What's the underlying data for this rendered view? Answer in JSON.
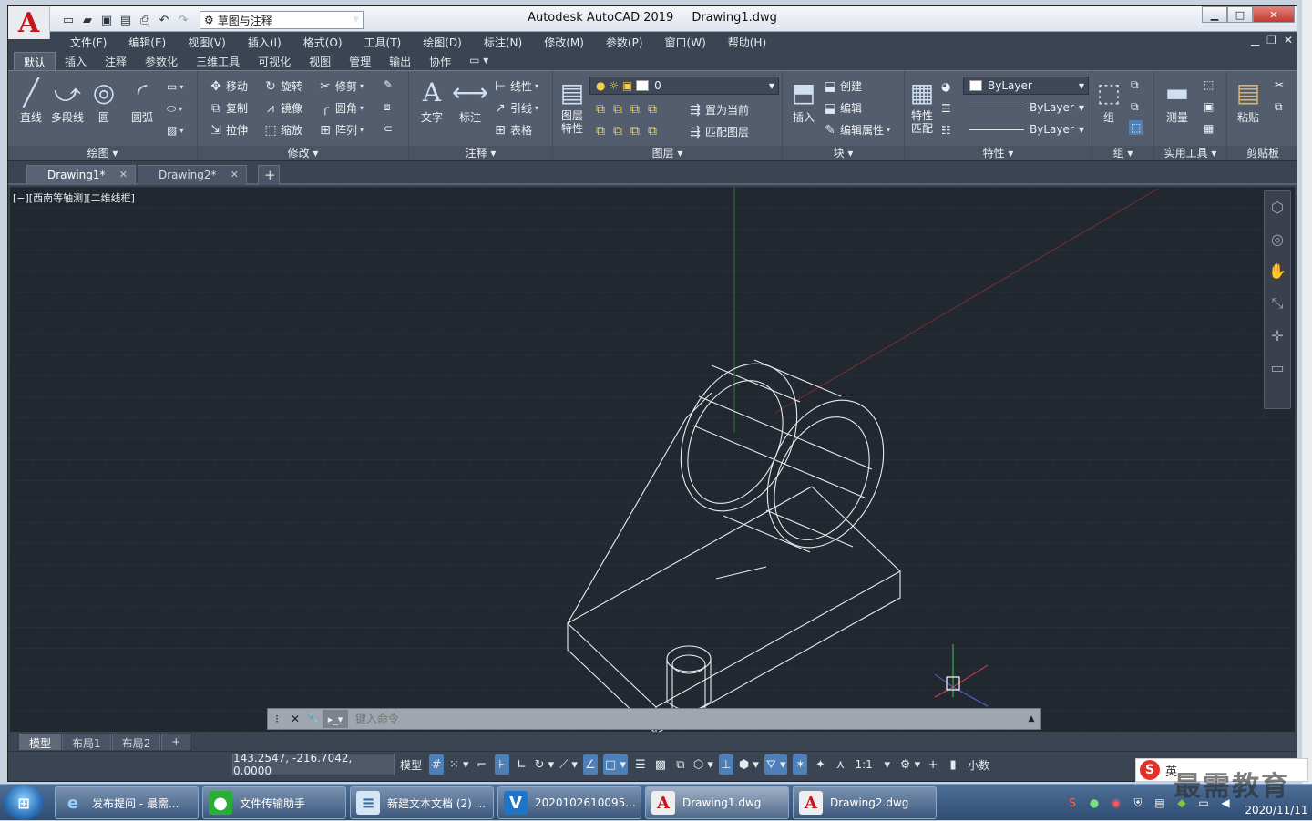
{
  "window": {
    "title_app": "Autodesk AutoCAD 2019",
    "title_file": "Drawing1.dwg",
    "logo": "A"
  },
  "qat": {
    "workspace": "草图与注释"
  },
  "menus": [
    "文件(F)",
    "编辑(E)",
    "视图(V)",
    "插入(I)",
    "格式(O)",
    "工具(T)",
    "绘图(D)",
    "标注(N)",
    "修改(M)",
    "参数(P)",
    "窗口(W)",
    "帮助(H)"
  ],
  "ribbon_tabs": [
    "默认",
    "插入",
    "注释",
    "参数化",
    "三维工具",
    "可视化",
    "视图",
    "管理",
    "输出",
    "协作"
  ],
  "ribbon": {
    "draw": {
      "title": "绘图",
      "line": "直线",
      "polyline": "多段线",
      "circle": "圆",
      "arc": "圆弧"
    },
    "modify": {
      "title": "修改",
      "move": "移动",
      "rotate": "旋转",
      "trim": "修剪",
      "copy": "复制",
      "mirror": "镜像",
      "fillet": "圆角",
      "stretch": "拉伸",
      "scale": "缩放",
      "array": "阵列"
    },
    "annotation": {
      "title": "注释",
      "text": "文字",
      "dimension": "标注",
      "linear": "线性",
      "leader": "引线",
      "table": "表格"
    },
    "layers": {
      "title": "图层",
      "layer_props_1": "图层",
      "layer_props_2": "特性",
      "current_layer": "0",
      "set_current": "置为当前",
      "match_layer": "匹配图层"
    },
    "block": {
      "title": "块",
      "insert": "插入",
      "create": "创建",
      "edit": "编辑",
      "edit_attr": "编辑属性"
    },
    "properties": {
      "title": "特性",
      "match_1": "特性",
      "match_2": "匹配",
      "color": "ByLayer",
      "linetype": "ByLayer",
      "lineweight": "ByLayer"
    },
    "groups": {
      "title": "组",
      "group": "组"
    },
    "utilities": {
      "title": "实用工具",
      "measure": "测量"
    },
    "clipboard": {
      "title": "剪贴板",
      "paste": "粘贴"
    }
  },
  "doc_tabs": [
    {
      "label": "Drawing1*",
      "active": true
    },
    {
      "label": "Drawing2*",
      "active": false
    }
  ],
  "viewport_label": "[−][西南等轴测][二维线框]",
  "command": {
    "placeholder": "键入命令"
  },
  "layout_tabs": [
    "模型",
    "布局1",
    "布局2"
  ],
  "status": {
    "coords": "143.2547, -216.7042, 0.0000",
    "model": "模型",
    "scale": "1:1",
    "units": "小数"
  },
  "taskbar": {
    "items": [
      {
        "label": "发布提问 - 最需...",
        "icon": "ie-icon",
        "glyph": "e",
        "color": "#2f8fd8"
      },
      {
        "label": "文件传输助手",
        "icon": "wechat-icon",
        "glyph": "●",
        "color": "#2aae37"
      },
      {
        "label": "新建文本文档 (2) ...",
        "icon": "notepad-icon",
        "glyph": "≡",
        "color": "#6aa7d8"
      },
      {
        "label": "2020102610095...",
        "icon": "video-icon",
        "glyph": "V",
        "color": "#1e74c8"
      },
      {
        "label": "Drawing1.dwg",
        "icon": "autocad-icon",
        "glyph": "A",
        "color": "#c8141b"
      },
      {
        "label": "Drawing2.dwg",
        "icon": "autocad-icon",
        "glyph": "A",
        "color": "#c8141b"
      }
    ],
    "date": "2020/11/11",
    "ime_lang": "英",
    "watermark": "最需教育"
  },
  "colors": {
    "canvas": "#212830",
    "ribbon": "#535d6d",
    "accent": "#4d7fb8"
  }
}
